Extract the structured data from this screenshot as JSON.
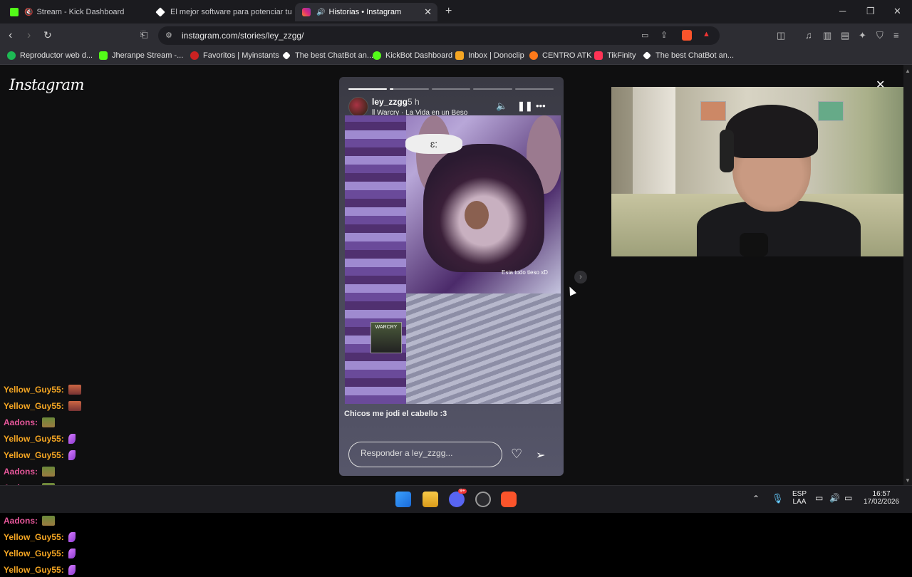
{
  "browser": {
    "tabs": [
      {
        "title": "Stream - Kick Dashboard",
        "muted": true,
        "favicon_color": "#53fc18"
      },
      {
        "title": "El mejor software para potenciar tu st",
        "favicon_color": "#ffffff"
      },
      {
        "title": "Historias • Instagram",
        "sound": true,
        "active": true,
        "favicon_color": "#e1306c"
      }
    ],
    "new_tab_label": "+",
    "url": "instagram.com/stories/ley_zzgg/",
    "bookmarks": [
      {
        "label": "Reproductor web d...",
        "color": "#1db954"
      },
      {
        "label": "Jheranpe Stream -...",
        "color": "#53fc18"
      },
      {
        "label": "Favoritos | Myinstants",
        "color": "#cc2222"
      },
      {
        "label": "The best ChatBot an...",
        "color": "#ffffff"
      },
      {
        "label": "KickBot Dashboard",
        "color": "#53fc18"
      },
      {
        "label": "Inbox | Donoclip",
        "color": "#f5a623"
      },
      {
        "label": "CENTRO ATK",
        "color": "#ff7a1a"
      },
      {
        "label": "TikFinity",
        "color": "#ff3355"
      },
      {
        "label": "The best ChatBot an...",
        "color": "#ffffff"
      }
    ]
  },
  "instagram": {
    "logo": "Instagram",
    "story": {
      "username": "ley_zzgg",
      "time": "5 h",
      "music": "Warcry · La Vida en un Beso",
      "progress": [
        1,
        0.08,
        0,
        0,
        0
      ],
      "bubble_text": "ɛ:",
      "overlay_text": "Esta todo tieso xD",
      "album_text": "WARCRY",
      "caption": "Chicos me jodi el cabello :3",
      "reply_placeholder": "Responder a ley_zzgg..."
    }
  },
  "chat": [
    {
      "user": "Yellow_Guy55:",
      "color": "#f5a623",
      "emote": "block"
    },
    {
      "user": "Yellow_Guy55:",
      "color": "#f5a623",
      "emote": "block"
    },
    {
      "user": "Aadons:",
      "color": "#e8579b",
      "emote": "green"
    },
    {
      "user": "Yellow_Guy55:",
      "color": "#f5a623",
      "emote": "feather"
    },
    {
      "user": "Yellow_Guy55:",
      "color": "#f5a623",
      "emote": "feather"
    },
    {
      "user": "Aadons:",
      "color": "#e8579b",
      "emote": "green"
    },
    {
      "user": "Aadons:",
      "color": "#e8579b",
      "emote": "green"
    },
    {
      "user": "Aadons:",
      "color": "#e8579b",
      "emote": "green"
    },
    {
      "user": "Aadons:",
      "color": "#e8579b",
      "emote": "green"
    },
    {
      "user": "Yellow_Guy55:",
      "color": "#f5a623",
      "emote": "feather"
    },
    {
      "user": "Yellow_Guy55:",
      "color": "#f5a623",
      "emote": "feather"
    },
    {
      "user": "Yellow_Guy55:",
      "color": "#f5a623",
      "emote": "feather"
    }
  ],
  "taskbar": {
    "lang": "ESP",
    "lang_sub": "LAA",
    "time": "16:57",
    "date": "17/02/2026",
    "discord_badge": "9+"
  }
}
